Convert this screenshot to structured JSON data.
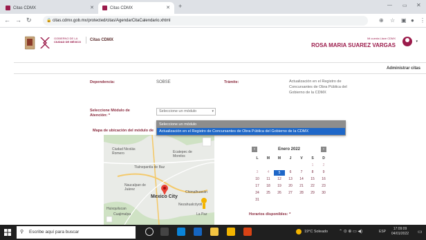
{
  "browser": {
    "tabs": [
      {
        "title": "Citas CDMX"
      },
      {
        "title": "Citas CDMX"
      }
    ],
    "url": "citas.cdmx.gob.mx/protected/citas/AgendarCitaCalendario.xhtml"
  },
  "header": {
    "brand_top": "GOBIERNO DE LA",
    "brand_bottom": "CIUDAD DE MÉXICO",
    "app_name": "Citas CDMX",
    "user_sub": "Mi cuenta Llave CDMX",
    "user_name": "ROSA MARIA SUAREZ VARGAS"
  },
  "admin_link": "Administrar citas",
  "form": {
    "dependencia_label": "Dependencia:",
    "dependencia_value": "SOBSE",
    "tramite_label": "Trámite:",
    "tramite_value": "Actualización en el Registro de Concursantes de Obra Pública del Gobierno de la CDMX",
    "modulo_label": "Seleccione Módulo de Atención: *",
    "modulo_select": "Seleccione un módulo",
    "dropdown_options": [
      "Seleccione un módulo",
      "Actualización en el Registro de Concursantes de Obra Pública del Gobierno de la CDMX"
    ],
    "map_label": "Mapa de ubicación del módulo de",
    "horarios_label": "Horarios disponibles: *"
  },
  "map": {
    "labels": [
      "Ciudad Nicolás Romero",
      "Ecatepec de Morelos",
      "Tlalnepantla de Baz",
      "Naucalpan de Juárez",
      "Mexico City",
      "Chimalhuacán",
      "Nezahualcóyotl",
      "La Paz",
      "Huixquilucan",
      "Cuajimalpa"
    ]
  },
  "calendar": {
    "month": "Enero 2022",
    "days_of_week": [
      "L",
      "M",
      "M",
      "J",
      "V",
      "S",
      "D"
    ],
    "weeks": [
      [
        "",
        "",
        "",
        "",
        "",
        "1",
        "2"
      ],
      [
        "3",
        "4",
        "5",
        "6",
        "7",
        "8",
        "9"
      ],
      [
        "10",
        "11",
        "12",
        "13",
        "14",
        "15",
        "16"
      ],
      [
        "17",
        "18",
        "19",
        "20",
        "21",
        "22",
        "23"
      ],
      [
        "24",
        "25",
        "26",
        "27",
        "28",
        "29",
        "30"
      ],
      [
        "31",
        "",
        "",
        "",
        "",
        "",
        ""
      ]
    ],
    "selected_day": "5"
  },
  "taskbar": {
    "search_placeholder": "Escribe aquí para buscar",
    "weather": "19°C Soleado",
    "lang": "ESP",
    "time": "17:09:09",
    "date": "04/01/2022"
  },
  "colors": {
    "brand": "#9b1b4b",
    "highlight": "#1e67c8"
  }
}
